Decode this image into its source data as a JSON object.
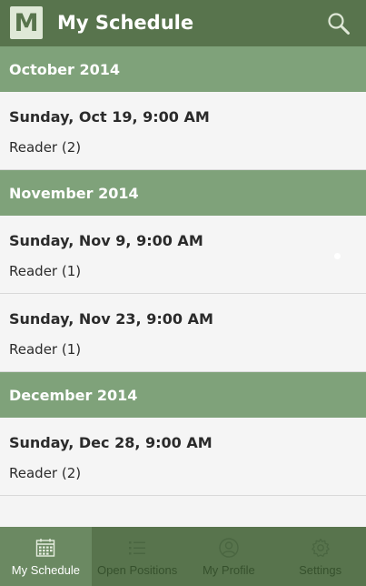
{
  "app": {
    "logo_letter": "M",
    "title": "My Schedule",
    "search_icon": "search-icon"
  },
  "sections": [
    {
      "header": "October 2014",
      "items": [
        {
          "date": "Sunday, Oct 19, 9:00 AM",
          "role": "Reader (2)"
        }
      ]
    },
    {
      "header": "November 2014",
      "items": [
        {
          "date": "Sunday, Nov 9, 9:00 AM",
          "role": "Reader (1)"
        },
        {
          "date": "Sunday, Nov 23, 9:00 AM",
          "role": "Reader (1)"
        }
      ]
    },
    {
      "header": "December 2014",
      "items": [
        {
          "date": "Sunday, Dec 28, 9:00 AM",
          "role": "Reader (2)"
        }
      ]
    }
  ],
  "bottom_nav": {
    "tabs": [
      {
        "label": "My Schedule",
        "icon": "calendar-icon",
        "active": true
      },
      {
        "label": "Open Positions",
        "icon": "list-icon",
        "active": false
      },
      {
        "label": "My Profile",
        "icon": "profile-icon",
        "active": false
      },
      {
        "label": "Settings",
        "icon": "gear-icon",
        "active": false
      }
    ]
  },
  "colors": {
    "appbar": "#58744d",
    "section_header": "#7fa27a",
    "background": "#f5f5f5",
    "nav_active": "#6b8962",
    "nav_inactive_label": "#36512d"
  }
}
